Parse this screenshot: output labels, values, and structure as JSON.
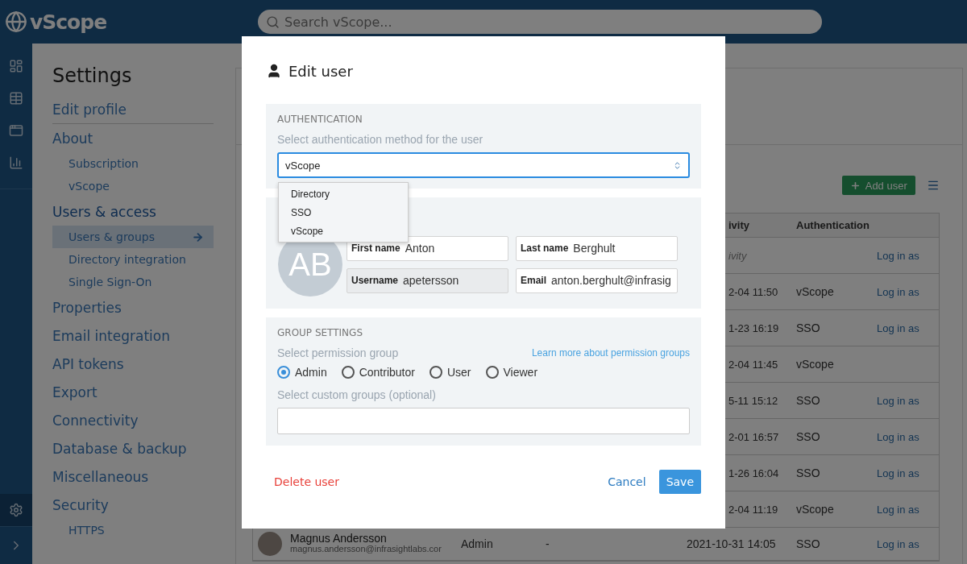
{
  "topbar": {
    "logo": "vScope",
    "search_placeholder": "Search vScope..."
  },
  "rail": [
    {
      "kind": "dashboard",
      "selected": false
    },
    {
      "kind": "table",
      "selected": false
    },
    {
      "kind": "window",
      "selected": false
    },
    {
      "kind": "report",
      "selected": false
    }
  ],
  "rail_bottom": [
    {
      "kind": "settings",
      "selected": true
    },
    {
      "kind": "expand",
      "selected": false
    }
  ],
  "settings_nav": {
    "title": "Settings",
    "items": [
      {
        "label": "Edit profile",
        "selected": false
      },
      {
        "label": "About",
        "selected": false,
        "children": [
          {
            "label": "Subscription",
            "selected": false
          },
          {
            "label": "vScope",
            "selected": false
          }
        ]
      },
      {
        "label": "Users & access",
        "selected": true,
        "children": [
          {
            "label": "Users & groups",
            "selected": true
          },
          {
            "label": "Directory integration",
            "selected": false
          },
          {
            "label": "Single Sign-On",
            "selected": false
          }
        ]
      },
      {
        "label": "Properties",
        "selected": false
      },
      {
        "label": "Email integration",
        "selected": false
      },
      {
        "label": "API tokens",
        "selected": false
      },
      {
        "label": "Export",
        "selected": false
      },
      {
        "label": "Connectivity",
        "selected": false
      },
      {
        "label": "Database & backup",
        "selected": false
      },
      {
        "label": "Miscellaneous",
        "selected": false
      },
      {
        "label": "Security",
        "selected": false,
        "children": [
          {
            "label": "HTTPS",
            "selected": false
          }
        ]
      }
    ]
  },
  "users": {
    "add_button": "Add user",
    "columns": [
      "ivity",
      "Authentication"
    ],
    "rows": [
      {
        "activity": "ivity",
        "activity_muted": true,
        "auth": "",
        "action": "Log in as"
      },
      {
        "activity": "2-04 11:50",
        "auth": "vScope",
        "action": "Log in as"
      },
      {
        "activity": "1-23 16:19",
        "auth": "SSO",
        "action": "Log in as"
      },
      {
        "activity": "2-04 11:45",
        "auth": "vScope",
        "action": ""
      },
      {
        "activity": "5-11 15:12",
        "auth": "SSO",
        "action": "Log in as"
      },
      {
        "activity": "2-01 16:57",
        "auth": "SSO",
        "action": "Log in as"
      },
      {
        "activity": "1-26 16:04",
        "auth": "SSO",
        "action": "Log in as"
      },
      {
        "activity": "2-04 11:19",
        "auth": "vScope",
        "action": "Log in as"
      },
      {
        "name": "Magnus Andersson",
        "email": "magnus.andersson@infrasightlabs.cor",
        "role": "Admin",
        "column_3": "-",
        "activity": "2021-10-31 14:05",
        "auth": "SSO",
        "action": "Log in as"
      }
    ]
  },
  "modal": {
    "title": "Edit user",
    "authentication": {
      "heading": "AUTHENTICATION",
      "hint": "Select authentication method for the user",
      "value": "vScope",
      "options": [
        "Directory",
        "SSO",
        "vScope"
      ]
    },
    "user": {
      "initials": "AB",
      "fields": [
        {
          "label": "First name",
          "value": "Anton",
          "disabled": false
        },
        {
          "label": "Last name",
          "value": "Berghult",
          "disabled": false
        },
        {
          "label": "Username",
          "value": "apetersson",
          "disabled": true
        },
        {
          "label": "Email",
          "value": "anton.berghult@infrasig",
          "disabled": false
        }
      ]
    },
    "groups": {
      "heading": "GROUP SETTINGS",
      "hint": "Select permission group",
      "link": "Learn more about permission groups",
      "permissions": [
        {
          "label": "Admin",
          "selected": true
        },
        {
          "label": "Contributor",
          "selected": false
        },
        {
          "label": "User",
          "selected": false
        },
        {
          "label": "Viewer",
          "selected": false
        }
      ],
      "custom_hint": "Select custom groups (optional)"
    },
    "delete": "Delete user",
    "cancel": "Cancel",
    "save": "Save"
  }
}
